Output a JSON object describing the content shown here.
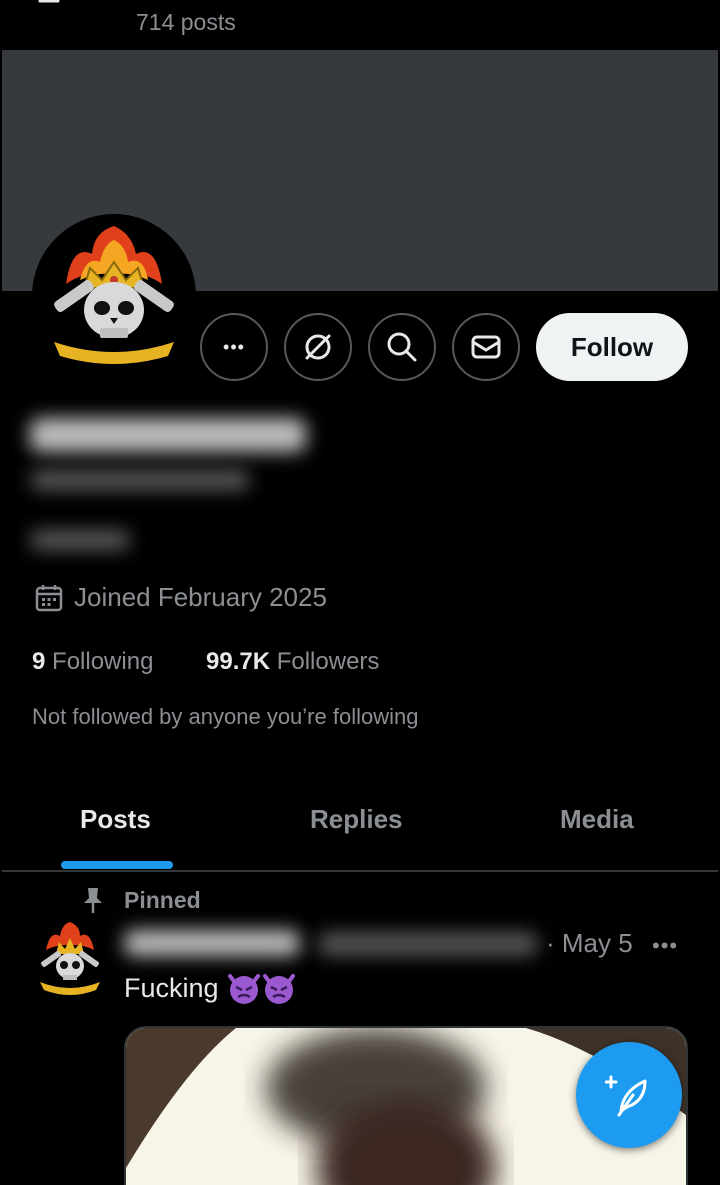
{
  "header": {
    "post_count": "714 posts"
  },
  "profile": {
    "joined": "Joined February 2025",
    "following_count": "9",
    "following_label": "Following",
    "followers_count": "99.7K",
    "followers_label": "Followers",
    "not_followed_text": "Not followed by anyone you’re following"
  },
  "actions": {
    "follow_label": "Follow",
    "more_label": "•••"
  },
  "tabs": [
    {
      "label": "Posts",
      "active": true
    },
    {
      "label": "Replies",
      "active": false
    },
    {
      "label": "Media",
      "active": false
    }
  ],
  "pinned_post": {
    "pinned_label": "Pinned",
    "date": "· May 5",
    "more": "•••",
    "text": "Fucking"
  },
  "colors": {
    "accent": "#1d9bf0",
    "banner": "#36393d",
    "muted_text": "#8b8f93"
  }
}
